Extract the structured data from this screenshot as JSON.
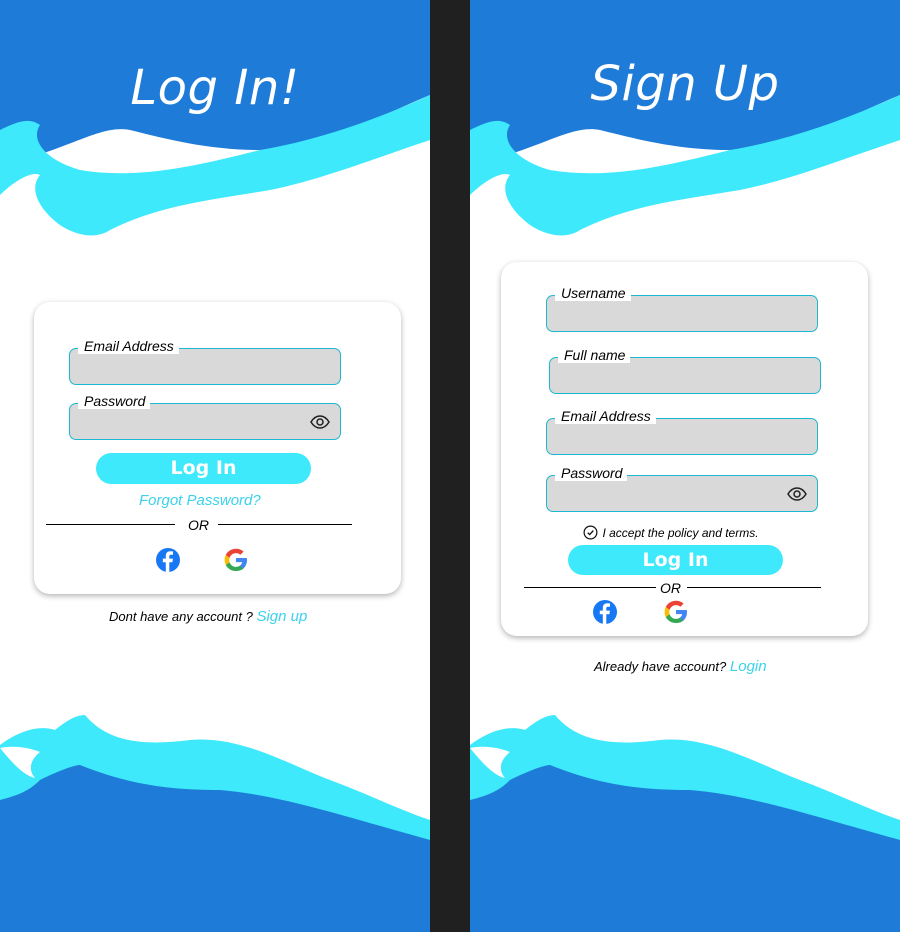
{
  "colors": {
    "primary_blue": "#1e7cd8",
    "accent_cyan": "#3de9fb",
    "field_gray": "#d9d9d9",
    "divider_dark": "#202020"
  },
  "login": {
    "title": "Log In!",
    "fields": [
      {
        "label": "Email Address",
        "value": "",
        "icon": ""
      },
      {
        "label": "Password",
        "value": "",
        "icon": "eye-icon"
      }
    ],
    "submit_label": "Log In",
    "forgot_label": "Forgot Password?",
    "or_label": "OR",
    "social": [
      "facebook-icon",
      "google-icon"
    ],
    "footer_text": "Dont have any account ?",
    "footer_link": "Sign up"
  },
  "signup": {
    "title": "Sign Up",
    "fields": [
      {
        "label": "Username",
        "value": "",
        "icon": ""
      },
      {
        "label": "Full name",
        "value": "",
        "icon": ""
      },
      {
        "label": "Email Address",
        "value": "",
        "icon": ""
      },
      {
        "label": "Password",
        "value": "",
        "icon": "eye-icon"
      }
    ],
    "policy_label": "I accept the policy and terms.",
    "policy_checked": true,
    "submit_label": "Log In",
    "or_label": "OR",
    "social": [
      "facebook-icon",
      "google-icon"
    ],
    "footer_text": "Already have account?",
    "footer_link": "Login"
  }
}
